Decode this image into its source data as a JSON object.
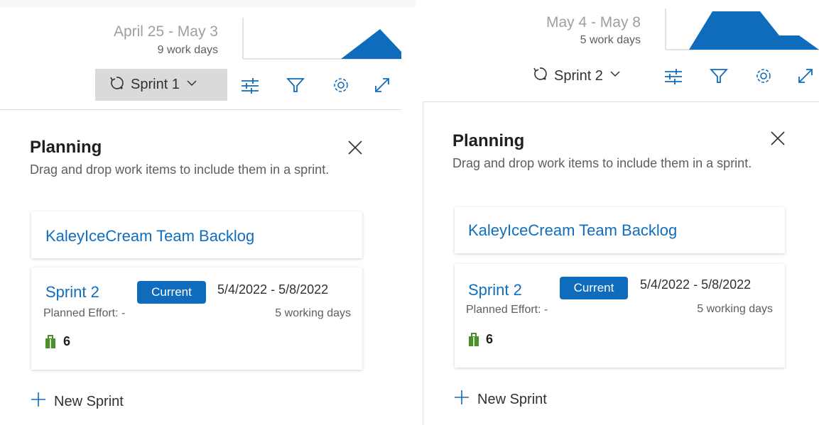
{
  "colors": {
    "accent": "#0f6cbd",
    "link": "#106ebe",
    "bag": "#4e8f2c"
  },
  "left": {
    "date_range": "April 25 - May 3",
    "work_days": "9 work days",
    "sprint_picker": "Sprint 1",
    "planning": {
      "title": "Planning",
      "description": "Drag and drop work items to include them in a sprint.",
      "backlog_link": "KaleyIceCream Team Backlog",
      "sprint": {
        "name": "Sprint 2",
        "badge": "Current",
        "dates": "5/4/2022 - 5/8/2022",
        "planned_effort": "Planned Effort: -",
        "working_days": "5 working days",
        "item_count": "6"
      },
      "new_sprint": "New Sprint"
    }
  },
  "right": {
    "date_range": "May 4 - May 8",
    "work_days": "5 work days",
    "sprint_picker": "Sprint 2",
    "planning": {
      "title": "Planning",
      "description": "Drag and drop work items to include them in a sprint.",
      "backlog_link": "KaleyIceCream Team Backlog",
      "sprint": {
        "name": "Sprint 2",
        "badge": "Current",
        "dates": "5/4/2022 - 5/8/2022",
        "planned_effort": "Planned Effort: -",
        "working_days": "5 working days",
        "item_count": "6"
      },
      "new_sprint": "New Sprint"
    }
  }
}
